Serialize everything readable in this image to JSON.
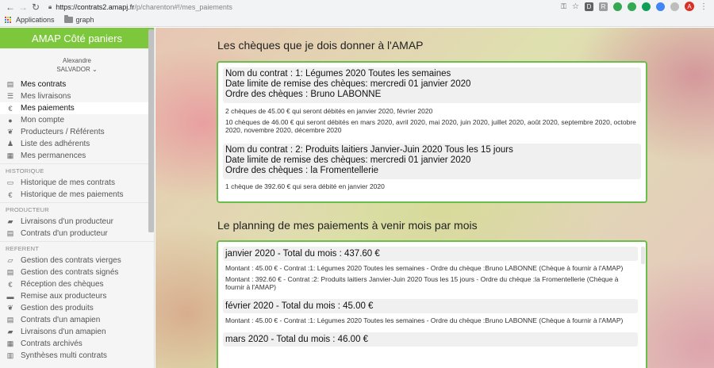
{
  "browser": {
    "url_host": "https://contrats2.amapj.fr",
    "url_path": "/p/charenton#!/mes_paiements",
    "bookmarks": [
      {
        "label": "Applications"
      },
      {
        "label": "graph"
      }
    ],
    "extensions": [
      {
        "icon": "key-icon",
        "color": "#5f6368"
      },
      {
        "icon": "star-icon",
        "color": "#5f6368"
      },
      {
        "icon": "ext-d-icon",
        "color": "#616161"
      },
      {
        "icon": "ext-r-icon",
        "color": "#9e9e9e"
      },
      {
        "icon": "ext-green-1-icon",
        "color": "#34a853"
      },
      {
        "icon": "ext-green-2-icon",
        "color": "#34a853"
      },
      {
        "icon": "ext-green-3-icon",
        "color": "#0f9d58"
      },
      {
        "icon": "ext-blue-icon",
        "color": "#4285f4"
      },
      {
        "icon": "ext-gray-icon",
        "color": "#bdbdbd"
      },
      {
        "icon": "avatar-icon",
        "color": "#d93025",
        "letter": "A"
      },
      {
        "icon": "menu-kebab-icon",
        "color": "#5f6368"
      }
    ]
  },
  "sidebar": {
    "app_title": "AMAP Côté paniers",
    "user_first": "Alexandre",
    "user_last": "SALVADOR ⌄",
    "items_top": [
      {
        "label": "Mes contrats",
        "icon": "clipboard-icon",
        "glyph": "▤",
        "active": false,
        "bold": true
      },
      {
        "label": "Mes livraisons",
        "icon": "list-icon",
        "glyph": "☰",
        "active": false
      },
      {
        "label": "Mes paiements",
        "icon": "euro-icon",
        "glyph": "€",
        "active": true
      },
      {
        "label": "Mon compte",
        "icon": "user-icon",
        "glyph": "●",
        "active": false
      },
      {
        "label": "Producteurs / Référents",
        "icon": "leaf-icon",
        "glyph": "❦",
        "active": false
      },
      {
        "label": "Liste des adhérents",
        "icon": "users-icon",
        "glyph": "♟",
        "active": false
      },
      {
        "label": "Mes permanences",
        "icon": "calendar-icon",
        "glyph": "▦",
        "active": false
      }
    ],
    "section_historique": "HISTORIQUE",
    "items_historique": [
      {
        "label": "Historique de mes contrats",
        "icon": "folder-icon",
        "glyph": "▭"
      },
      {
        "label": "Historique de mes paiements",
        "icon": "euro-icon",
        "glyph": "€"
      }
    ],
    "section_producteur": "PRODUCTEUR",
    "items_producteur": [
      {
        "label": "Livraisons d'un producteur",
        "icon": "truck-icon",
        "glyph": "▰"
      },
      {
        "label": "Contrats d'un producteur",
        "icon": "document-icon",
        "glyph": "▤"
      }
    ],
    "section_referent": "REFERENT",
    "items_referent": [
      {
        "label": "Gestion des contrats vierges",
        "icon": "folder-open-icon",
        "glyph": "▱"
      },
      {
        "label": "Gestion des contrats signés",
        "icon": "file-signed-icon",
        "glyph": "▤"
      },
      {
        "label": "Réception des chèques",
        "icon": "euro-icon",
        "glyph": "€"
      },
      {
        "label": "Remise aux producteurs",
        "icon": "money-icon",
        "glyph": "▬"
      },
      {
        "label": "Gestion des produits",
        "icon": "leaf-icon",
        "glyph": "❦"
      },
      {
        "label": "Contrats d'un amapien",
        "icon": "document-icon",
        "glyph": "▤"
      },
      {
        "label": "Livraisons d'un amapien",
        "icon": "truck-icon",
        "glyph": "▰"
      },
      {
        "label": "Contrats archivés",
        "icon": "archive-icon",
        "glyph": "▦"
      },
      {
        "label": "Synthèses multi contrats",
        "icon": "chart-icon",
        "glyph": "▥"
      }
    ]
  },
  "main": {
    "cheques_title": "Les chèques que je dois donner à l'AMAP",
    "contracts": [
      {
        "name": "Nom du contrat : 1: Légumes 2020 Toutes les semaines",
        "deadline": "Date limite de remise des chèques: mercredi 01 janvier 2020",
        "order": "Ordre des chèques : Bruno LABONNE",
        "lines": [
          "2 chèques de 45.00 € qui seront débités en janvier 2020, février 2020",
          "10 chèques de 46.00 € qui seront débités en mars 2020, avril 2020, mai 2020, juin 2020, juillet 2020, août 2020, septembre 2020, octobre 2020, novembre 2020, décembre 2020"
        ]
      },
      {
        "name": "Nom du contrat : 2: Produits laitiers Janvier-Juin 2020 Tous les 15 jours",
        "deadline": "Date limite de remise des chèques: mercredi 01 janvier 2020",
        "order": "Ordre des chèques : la Fromentellerie",
        "lines": [
          "1 chèque de 392.60 € qui sera débité en janvier 2020"
        ]
      }
    ],
    "planning_title": "Le planning de mes paiements à venir mois par mois",
    "months": [
      {
        "title": "janvier 2020 - Total du mois : 437.60 €",
        "lines": [
          "Montant : 45.00 € - Contrat :1: Légumes 2020 Toutes les semaines - Ordre du chèque :Bruno LABONNE (Chèque à fournir à l'AMAP)",
          "Montant : 392.60 € - Contrat :2: Produits laitiers Janvier-Juin 2020 Tous les 15 jours - Ordre du chèque :la Fromentellerie (Chèque à fournir à l'AMAP)"
        ]
      },
      {
        "title": "février 2020 - Total du mois : 45.00 €",
        "lines": [
          "Montant : 45.00 € - Contrat :1: Légumes 2020 Toutes les semaines - Ordre du chèque :Bruno LABONNE (Chèque à fournir à l'AMAP)"
        ]
      },
      {
        "title": "mars 2020 - Total du mois : 46.00 €",
        "lines": []
      }
    ]
  },
  "colors": {
    "accent_green": "#7dc73c",
    "card_border": "#6abf4b",
    "active_bg": "#ffffff"
  }
}
